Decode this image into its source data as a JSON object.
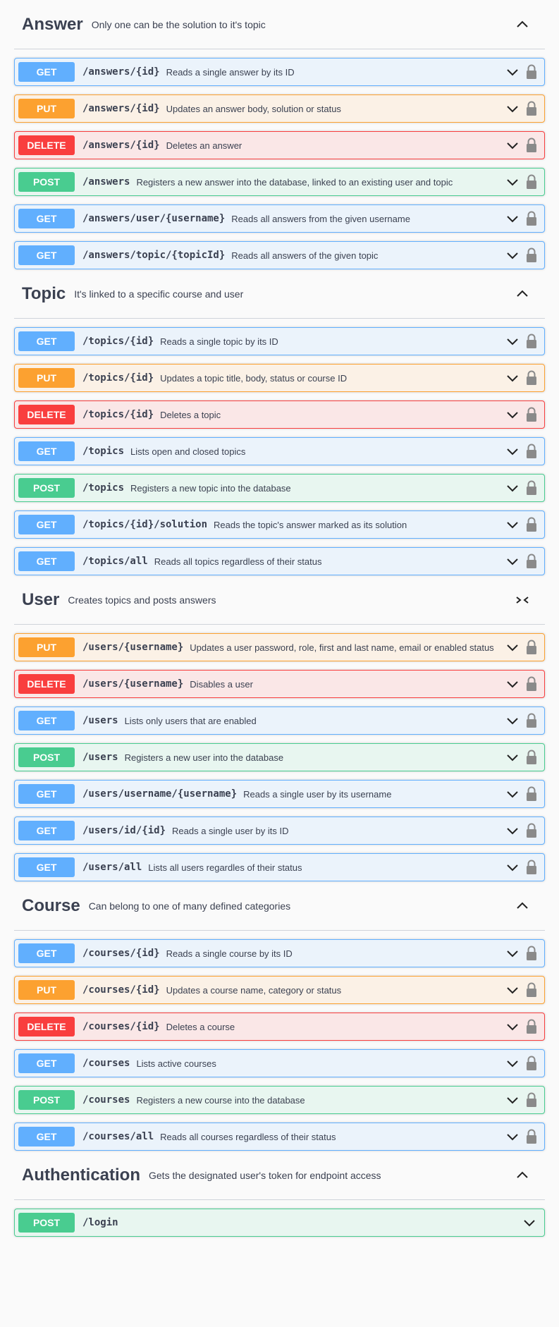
{
  "sections": [
    {
      "key": "answer",
      "title": "Answer",
      "description": "Only one can be the solution to it's topic",
      "toggle": "up",
      "operations": [
        {
          "method": "GET",
          "path": "/answers/{id}",
          "summary": "Reads a single answer by its ID"
        },
        {
          "method": "PUT",
          "path": "/answers/{id}",
          "summary": "Updates an answer body, solution or status"
        },
        {
          "method": "DELETE",
          "path": "/answers/{id}",
          "summary": "Deletes an answer"
        },
        {
          "method": "POST",
          "path": "/answers",
          "summary": "Registers a new answer into the database, linked to an existing user and topic"
        },
        {
          "method": "GET",
          "path": "/answers/user/{username}",
          "summary": "Reads all answers from the given username"
        },
        {
          "method": "GET",
          "path": "/answers/topic/{topicId}",
          "summary": "Reads all answers of the given topic"
        }
      ]
    },
    {
      "key": "topic",
      "title": "Topic",
      "description": "It's linked to a specific course and user",
      "toggle": "up",
      "operations": [
        {
          "method": "GET",
          "path": "/topics/{id}",
          "summary": "Reads a single topic by its ID"
        },
        {
          "method": "PUT",
          "path": "/topics/{id}",
          "summary": "Updates a topic title, body, status or course ID"
        },
        {
          "method": "DELETE",
          "path": "/topics/{id}",
          "summary": "Deletes a topic"
        },
        {
          "method": "GET",
          "path": "/topics",
          "summary": "Lists open and closed topics"
        },
        {
          "method": "POST",
          "path": "/topics",
          "summary": "Registers a new topic into the database"
        },
        {
          "method": "GET",
          "path": "/topics/{id}/solution",
          "summary": "Reads the topic's answer marked as its solution"
        },
        {
          "method": "GET",
          "path": "/topics/all",
          "summary": "Reads all topics regardless of their status"
        }
      ]
    },
    {
      "key": "user",
      "title": "User",
      "description": "Creates topics and posts answers",
      "toggle": "collapse",
      "operations": [
        {
          "method": "PUT",
          "path": "/users/{username}",
          "summary": "Updates a user password, role, first and last name, email or enabled status"
        },
        {
          "method": "DELETE",
          "path": "/users/{username}",
          "summary": "Disables a user"
        },
        {
          "method": "GET",
          "path": "/users",
          "summary": "Lists only users that are enabled"
        },
        {
          "method": "POST",
          "path": "/users",
          "summary": "Registers a new user into the database"
        },
        {
          "method": "GET",
          "path": "/users/username/{username}",
          "summary": "Reads a single user by its username"
        },
        {
          "method": "GET",
          "path": "/users/id/{id}",
          "summary": "Reads a single user by its ID"
        },
        {
          "method": "GET",
          "path": "/users/all",
          "summary": "Lists all users regardles of their status"
        }
      ]
    },
    {
      "key": "course",
      "title": "Course",
      "description": "Can belong to one of many defined categories",
      "toggle": "up",
      "operations": [
        {
          "method": "GET",
          "path": "/courses/{id}",
          "summary": "Reads a single course by its ID"
        },
        {
          "method": "PUT",
          "path": "/courses/{id}",
          "summary": "Updates a course name, category or status"
        },
        {
          "method": "DELETE",
          "path": "/courses/{id}",
          "summary": "Deletes a course"
        },
        {
          "method": "GET",
          "path": "/courses",
          "summary": "Lists active courses"
        },
        {
          "method": "POST",
          "path": "/courses",
          "summary": "Registers a new course into the database"
        },
        {
          "method": "GET",
          "path": "/courses/all",
          "summary": "Reads all courses regardless of their status"
        }
      ]
    },
    {
      "key": "authentication",
      "title": "Authentication",
      "description": "Gets the designated user's token for endpoint access",
      "toggle": "up",
      "operations": [
        {
          "method": "POST",
          "path": "/login",
          "summary": "",
          "locked": false
        }
      ]
    }
  ],
  "colors": {
    "get": "#61affe",
    "put": "#fca130",
    "delete": "#f93e3e",
    "post": "#49cc90",
    "text": "#3b4151",
    "lock": "#8a8a8a"
  },
  "icons": {
    "section_toggle_up": "chevron-up-icon",
    "section_toggle_collapse": "collapse-arrows-icon",
    "operation_expand": "chevron-down-icon",
    "operation_lock": "lock-icon"
  }
}
